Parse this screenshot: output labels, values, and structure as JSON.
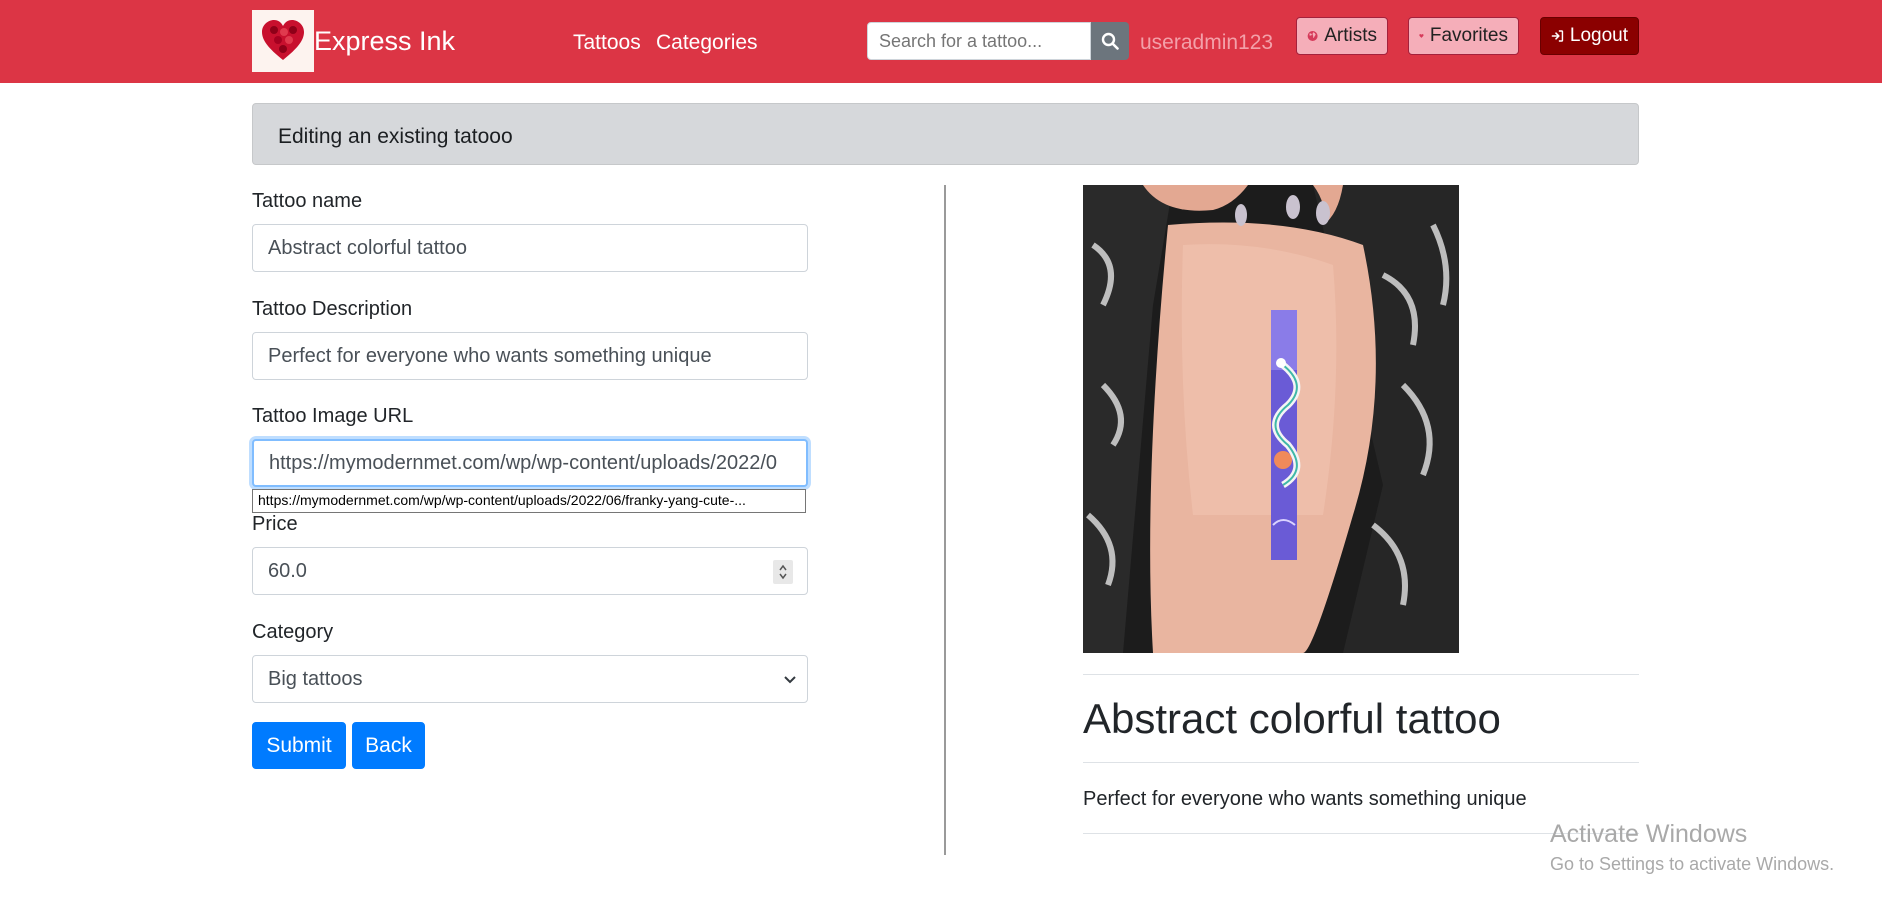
{
  "navbar": {
    "brand": "Express Ink",
    "links": [
      "Tattoos",
      "Categories"
    ],
    "search_placeholder": "Search for a tattoo...",
    "username": "useradmin123",
    "artists_label": "Artists",
    "favorites_label": "Favorites",
    "logout_label": "Logout"
  },
  "alert": {
    "text": "Editing an existing tatooo"
  },
  "form": {
    "name_label": "Tattoo name",
    "name_value": "Abstract colorful tattoo",
    "description_label": "Tattoo Description",
    "description_value": "Perfect for everyone who wants something unique",
    "image_url_label": "Tattoo Image URL",
    "image_url_value": "https://mymodernmet.com/wp/wp-content/uploads/2022/0",
    "image_url_tooltip": "https://mymodernmet.com/wp/wp-content/uploads/2022/06/franky-yang-cute-...",
    "price_label": "Price",
    "price_value": "60.0",
    "category_label": "Category",
    "category_value": "Big tattoos",
    "submit_label": "Submit",
    "back_label": "Back"
  },
  "preview": {
    "title": "Abstract colorful tattoo",
    "description": "Perfect for everyone who wants something unique"
  },
  "watermark": {
    "title": "Activate Windows",
    "subtitle": "Go to Settings to activate Windows."
  },
  "colors": {
    "navbar": "#dc3545",
    "primary": "#007bff",
    "logout": "#8b0000",
    "alert_bg": "#d6d8db"
  },
  "icons": [
    "heart-roses-logo",
    "search-icon",
    "globe-icon",
    "heart-icon",
    "sign-in-icon",
    "chevron-down-icon"
  ]
}
